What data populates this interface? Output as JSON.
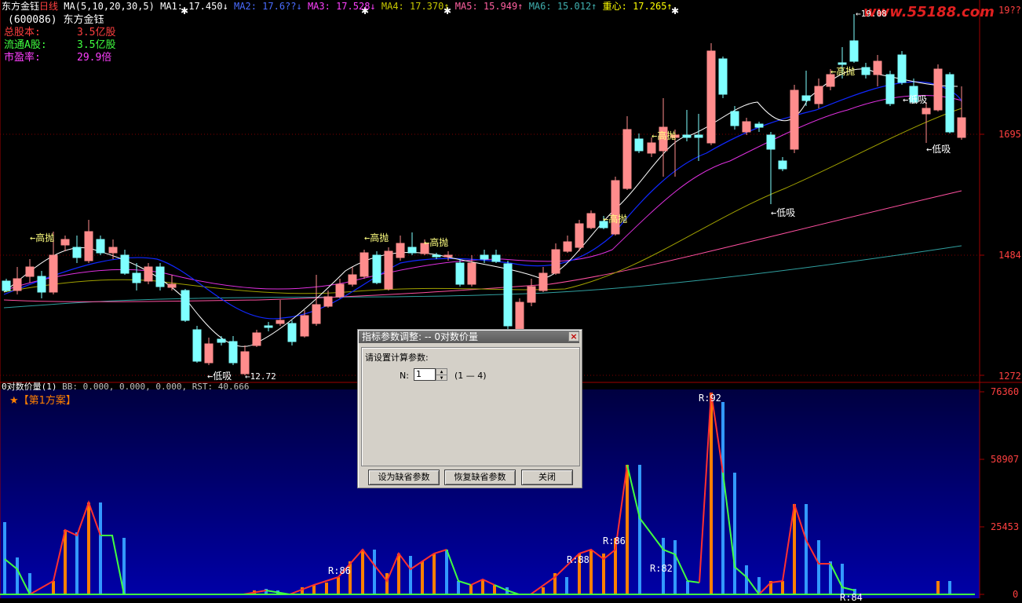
{
  "header": {
    "stock_name": "东方金钰",
    "period": "日线",
    "ma_params": "MA(5,10,20,30,5)",
    "ma_values": [
      {
        "label": "MA1:",
        "value": "17.450",
        "arrow": "↓",
        "color": "#ffffff"
      },
      {
        "label": "MA2:",
        "value": "17.6??",
        "arrow": "↓",
        "color": "#4a6cff"
      },
      {
        "label": "MA3:",
        "value": "17.528",
        "arrow": "↓",
        "color": "#ff40ff"
      },
      {
        "label": "MA4:",
        "value": "17.370",
        "arrow": "↑",
        "color": "#c8c800"
      },
      {
        "label": "MA5:",
        "value": "15.949",
        "arrow": "↑",
        "color": "#ff60a0"
      },
      {
        "label": "MA6:",
        "value": "15.012",
        "arrow": "↑",
        "color": "#40b0b0"
      },
      {
        "label": "重心:",
        "value": "17.265",
        "arrow": "↑",
        "color": "#ffff00"
      }
    ],
    "watermark": "www.55188.com"
  },
  "info": {
    "code": "(600086)",
    "name": "东方金钰",
    "rows": [
      {
        "label": "总股本:",
        "value": "3.5亿股",
        "color": "#ff4040"
      },
      {
        "label": "流通A股:",
        "value": "3.5亿股",
        "color": "#40ff40"
      },
      {
        "label": "市盈率:",
        "value": "29.9倍",
        "color": "#ff40ff"
      }
    ]
  },
  "price_axis": [
    "19??",
    "1695",
    "1484",
    "1272"
  ],
  "price_annotations": {
    "high": "←高抛",
    "low": "←低吸",
    "max_price": "←19.08",
    "min_price": "←12.72"
  },
  "indicator": {
    "title": "0对数价量(1)",
    "params": "BB: 0.000, 0.000, 0.000, RST: 40.666",
    "scheme": "★【第1方案】",
    "axis": [
      "76360",
      "58907",
      "25453",
      "0"
    ],
    "r_labels": [
      "R:92",
      "R:86",
      "R:88",
      "R:86",
      "R:82",
      "R:84"
    ]
  },
  "dialog": {
    "title": "指标参数调整: -- 0对数价量",
    "close": "×",
    "prompt": "请设置计算参数:",
    "param_label": "N:",
    "param_value": "1",
    "param_range": "(1 — 4)",
    "buttons": {
      "set_default": "设为缺省参数",
      "restore_default": "恢复缺省参数",
      "close": "关闭"
    }
  },
  "colors": {
    "up": "#ff8c8c",
    "down": "#7fffff",
    "grid": "#800000",
    "volume_bar_up": "#ff8000",
    "volume_bar_down": "#3399ff"
  }
}
